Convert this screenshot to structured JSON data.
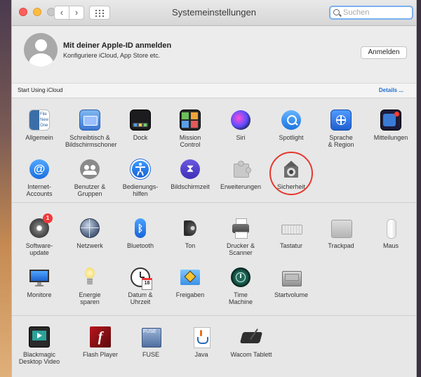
{
  "window": {
    "title": "Systemeinstellungen"
  },
  "search": {
    "placeholder": "Suchen"
  },
  "account": {
    "title": "Mit deiner Apple-ID anmelden",
    "subtitle": "Konfiguriere iCloud, App Store etc.",
    "login_label": "Anmelden"
  },
  "icloud": {
    "label": "Start Using iCloud",
    "details_label": "Details ..."
  },
  "row1": [
    {
      "line1": "Allgemein",
      "line2": "",
      "icon": "general-icon"
    },
    {
      "line1": "Schreibtisch &",
      "line2": "Bildschirmschoner",
      "icon": "desktop-screensaver-icon"
    },
    {
      "line1": "Dock",
      "line2": "",
      "icon": "dock-icon"
    },
    {
      "line1": "Mission",
      "line2": "Control",
      "icon": "mission-control-icon"
    },
    {
      "line1": "Siri",
      "line2": "",
      "icon": "siri-icon"
    },
    {
      "line1": "Spotlight",
      "line2": "",
      "icon": "spotlight-icon"
    },
    {
      "line1": "Sprache",
      "line2": "& Region",
      "icon": "language-region-icon"
    },
    {
      "line1": "Mitteilungen",
      "line2": "",
      "icon": "notifications-icon"
    }
  ],
  "row2": [
    {
      "line1": "Internet-",
      "line2": "Accounts",
      "icon": "internet-accounts-icon"
    },
    {
      "line1": "Benutzer &",
      "line2": "Gruppen",
      "icon": "users-groups-icon"
    },
    {
      "line1": "Bedienungs-",
      "line2": "hilfen",
      "icon": "accessibility-icon"
    },
    {
      "line1": "Bildschirmzeit",
      "line2": "",
      "icon": "screen-time-icon"
    },
    {
      "line1": "Erweiterungen",
      "line2": "",
      "icon": "extensions-icon"
    },
    {
      "line1": "Sicherheit",
      "line2": "",
      "icon": "security-icon"
    }
  ],
  "row3": [
    {
      "line1": "Software-",
      "line2": "update",
      "icon": "software-update-icon",
      "badge": "1"
    },
    {
      "line1": "Netzwerk",
      "line2": "",
      "icon": "network-icon"
    },
    {
      "line1": "Bluetooth",
      "line2": "",
      "icon": "bluetooth-icon"
    },
    {
      "line1": "Ton",
      "line2": "",
      "icon": "sound-icon"
    },
    {
      "line1": "Drucker &",
      "line2": "Scanner",
      "icon": "printer-icon"
    },
    {
      "line1": "Tastatur",
      "line2": "",
      "icon": "keyboard-icon"
    },
    {
      "line1": "Trackpad",
      "line2": "",
      "icon": "trackpad-icon"
    },
    {
      "line1": "Maus",
      "line2": "",
      "icon": "mouse-icon"
    }
  ],
  "row4": [
    {
      "line1": "Monitore",
      "line2": "",
      "icon": "displays-icon"
    },
    {
      "line1": "Energie",
      "line2": "sparen",
      "icon": "energy-saver-icon"
    },
    {
      "line1": "Datum &",
      "line2": "Uhrzeit",
      "icon": "date-time-icon",
      "calendar_day": "18"
    },
    {
      "line1": "Freigaben",
      "line2": "",
      "icon": "sharing-icon"
    },
    {
      "line1": "Time",
      "line2": "Machine",
      "icon": "time-machine-icon"
    },
    {
      "line1": "Startvolume",
      "line2": "",
      "icon": "startup-disk-icon"
    }
  ],
  "row5": [
    {
      "line1": "Blackmagic",
      "line2": "Desktop Video",
      "icon": "blackmagic-icon"
    },
    {
      "line1": "Flash Player",
      "line2": "",
      "icon": "flash-player-icon"
    },
    {
      "line1": "FUSE",
      "line2": "",
      "icon": "fuse-icon",
      "icon_text": "FUSE"
    },
    {
      "line1": "Java",
      "line2": "",
      "icon": "java-icon"
    },
    {
      "line1": "Wacom Tablett",
      "line2": "",
      "icon": "wacom-icon"
    }
  ],
  "general_icon_words": [
    "File",
    "New",
    "One"
  ],
  "colors": {
    "accent": "#1b6fd1",
    "highlight_ring": "#e4382f",
    "badge": "#f23a3a"
  }
}
